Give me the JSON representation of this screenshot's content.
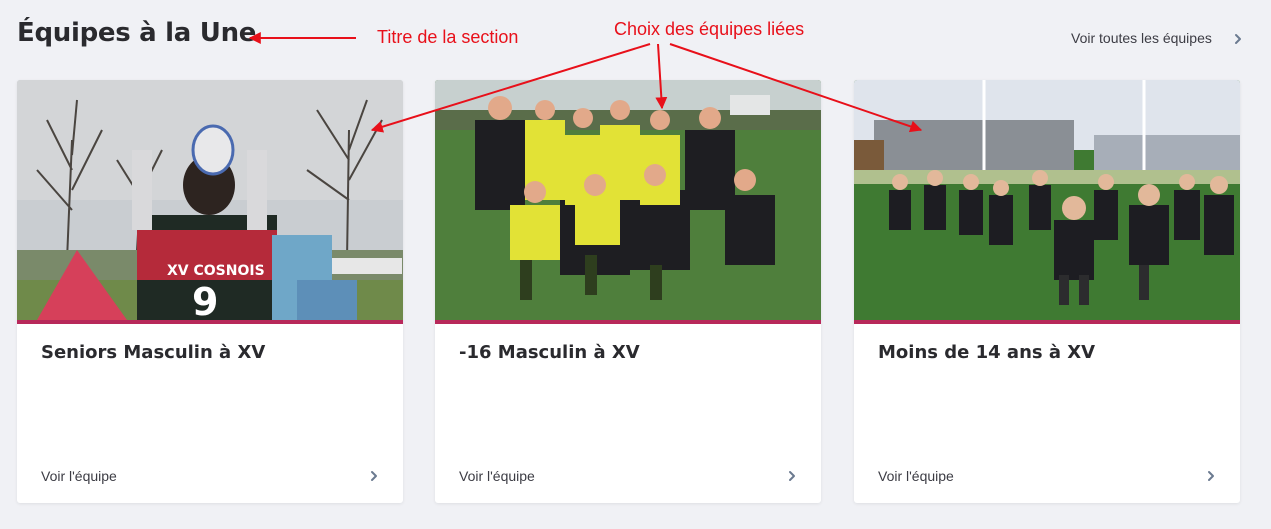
{
  "section": {
    "title": "Équipes à la Une",
    "see_all_label": "Voir toutes les équipes"
  },
  "cards": [
    {
      "title": "Seniors Masculin à XV",
      "link_label": "Voir l'équipe"
    },
    {
      "title": "-16 Masculin à XV",
      "link_label": "Voir l'équipe"
    },
    {
      "title": "Moins de 14 ans à XV",
      "link_label": "Voir l'équipe"
    }
  ],
  "annotations": {
    "section_title_note": "Titre de la section",
    "linked_teams_note": "Choix des équipes liées"
  },
  "colors": {
    "accent_band": "#b8295a",
    "annotation": "#e8101a",
    "chevron": "#6b7a90"
  },
  "icons": {
    "see_all": "chevron-right-icon",
    "card_link": "chevron-right-icon"
  }
}
